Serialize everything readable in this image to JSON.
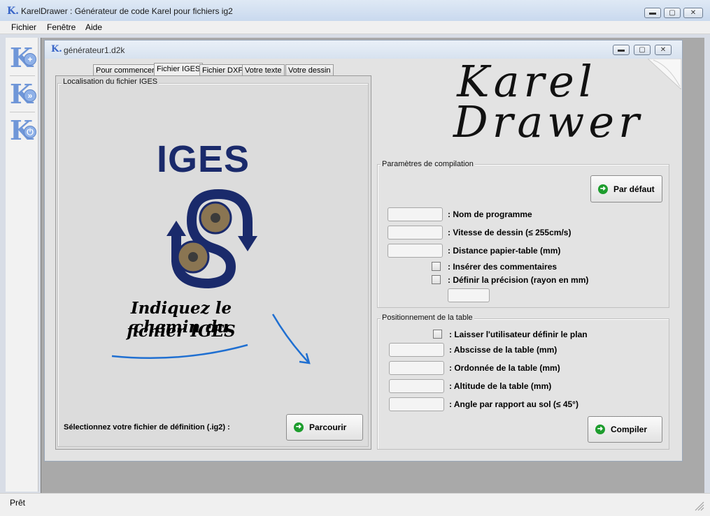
{
  "window": {
    "icon_letter": "K.",
    "title": "KarelDrawer : Générateur de code Karel pour fichiers ig2",
    "controls": {
      "minimize": "▬",
      "maximize": "▢",
      "close": "✕"
    }
  },
  "menu": {
    "items": [
      "Fichier",
      "Fenêtre",
      "Aide"
    ]
  },
  "toolbar": {
    "tools": [
      {
        "letter": "K",
        "badge": "+",
        "icon": "new-document-icon"
      },
      {
        "letter": "K",
        "badge": "»",
        "icon": "open-document-icon"
      },
      {
        "letter": "K",
        "badge": "⏻",
        "icon": "power-icon"
      }
    ]
  },
  "child": {
    "icon_letter": "K.",
    "title": "générateur1.d2k",
    "controls": {
      "minimize": "▬",
      "maximize": "▢",
      "close": "✕"
    }
  },
  "tabs": [
    {
      "label": "Pour commencer",
      "active": false
    },
    {
      "label": "Fichier IGES",
      "active": true
    },
    {
      "label": "Fichier DXF",
      "active": false
    },
    {
      "label": "Votre texte",
      "active": false
    },
    {
      "label": "Votre dessin",
      "active": false
    }
  ],
  "iges_panel": {
    "group_title": "Localisation du fichier IGES",
    "logo_text": "IGES",
    "hint_line1": "Indiquez le chemin du",
    "hint_line2": "fichier IGES",
    "select_label": "Sélectionnez votre fichier de définition (.ig2) :",
    "browse_button": "Parcourir"
  },
  "brand": {
    "line1": "Karel",
    "line2": "Drawer"
  },
  "compilation": {
    "group_title": "Paramètres de compilation",
    "default_button": "Par défaut",
    "fields": [
      {
        "label": ": Nom de programme",
        "value": ""
      },
      {
        "label": ": Vitesse de dessin (≤ 255cm/s)",
        "value": ""
      },
      {
        "label": ": Distance papier-table (mm)",
        "value": ""
      }
    ],
    "checkboxes": [
      {
        "label": ": Insérer des commentaires",
        "checked": false
      },
      {
        "label": ": Définir la précision (rayon en mm)",
        "checked": false
      }
    ],
    "precision_value": ""
  },
  "table_position": {
    "group_title": "Positionnement de la table",
    "checkbox": {
      "label": ": Laisser l'utilisateur définir le plan",
      "checked": false
    },
    "fields": [
      {
        "label": ": Abscisse de la table (mm)",
        "value": ""
      },
      {
        "label": ": Ordonnée de la table (mm)",
        "value": ""
      },
      {
        "label": ": Altitude de la table (mm)",
        "value": ""
      },
      {
        "label": ": Angle par rapport au sol (≤ 45°)",
        "value": ""
      }
    ],
    "compile_button": "Compiler"
  },
  "status": {
    "text": "Prêt"
  },
  "colors": {
    "iges_blue": "#1a2a6b",
    "accent_green": "#1e9d2e",
    "hint_blue": "#1f6fd1"
  }
}
